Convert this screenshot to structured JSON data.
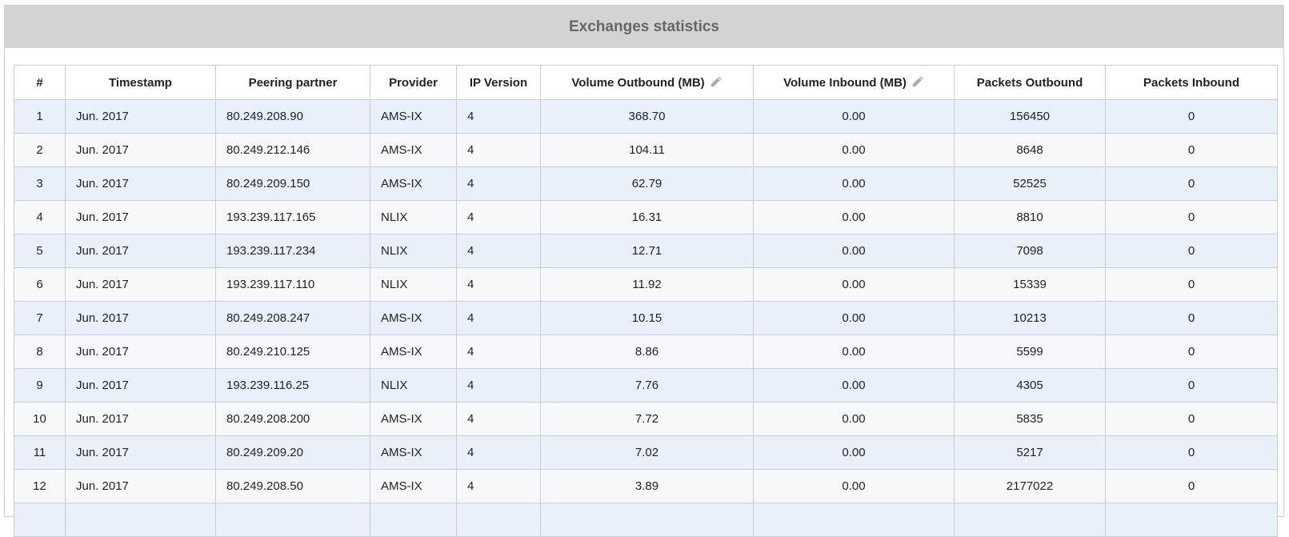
{
  "title": "Exchanges statistics",
  "columns": [
    "#",
    "Timestamp",
    "Peering partner",
    "Provider",
    "IP Version",
    "Volume Outbound (MB)",
    "Volume Inbound (MB)",
    "Packets Outbound",
    "Packets Inbound"
  ],
  "rows": [
    [
      "1",
      "Jun. 2017",
      "80.249.208.90",
      "AMS-IX",
      "4",
      "368.70",
      "0.00",
      "156450",
      "0"
    ],
    [
      "2",
      "Jun. 2017",
      "80.249.212.146",
      "AMS-IX",
      "4",
      "104.11",
      "0.00",
      "8648",
      "0"
    ],
    [
      "3",
      "Jun. 2017",
      "80.249.209.150",
      "AMS-IX",
      "4",
      "62.79",
      "0.00",
      "52525",
      "0"
    ],
    [
      "4",
      "Jun. 2017",
      "193.239.117.165",
      "NLIX",
      "4",
      "16.31",
      "0.00",
      "8810",
      "0"
    ],
    [
      "5",
      "Jun. 2017",
      "193.239.117.234",
      "NLIX",
      "4",
      "12.71",
      "0.00",
      "7098",
      "0"
    ],
    [
      "6",
      "Jun. 2017",
      "193.239.117.110",
      "NLIX",
      "4",
      "11.92",
      "0.00",
      "15339",
      "0"
    ],
    [
      "7",
      "Jun. 2017",
      "80.249.208.247",
      "AMS-IX",
      "4",
      "10.15",
      "0.00",
      "10213",
      "0"
    ],
    [
      "8",
      "Jun. 2017",
      "80.249.210.125",
      "AMS-IX",
      "4",
      "8.86",
      "0.00",
      "5599",
      "0"
    ],
    [
      "9",
      "Jun. 2017",
      "193.239.116.25",
      "NLIX",
      "4",
      "7.76",
      "0.00",
      "4305",
      "0"
    ],
    [
      "10",
      "Jun. 2017",
      "80.249.208.200",
      "AMS-IX",
      "4",
      "7.72",
      "0.00",
      "5835",
      "0"
    ],
    [
      "11",
      "Jun. 2017",
      "80.249.209.20",
      "AMS-IX",
      "4",
      "7.02",
      "0.00",
      "5217",
      "0"
    ],
    [
      "12",
      "Jun. 2017",
      "80.249.208.50",
      "AMS-IX",
      "4",
      "3.89",
      "0.00",
      "2177022",
      "0"
    ],
    [
      "",
      "",
      "",
      "",
      "",
      "",
      "",
      "",
      ""
    ]
  ],
  "icons": {
    "edit_volume_outbound": "pencil-icon",
    "edit_volume_inbound": "pencil-icon"
  },
  "colors": {
    "header_bg": "#d3d3d3",
    "header_text": "#666666",
    "row_odd": "#e9f0fa",
    "row_even": "#f6f8fc",
    "border": "#c9ced6"
  }
}
